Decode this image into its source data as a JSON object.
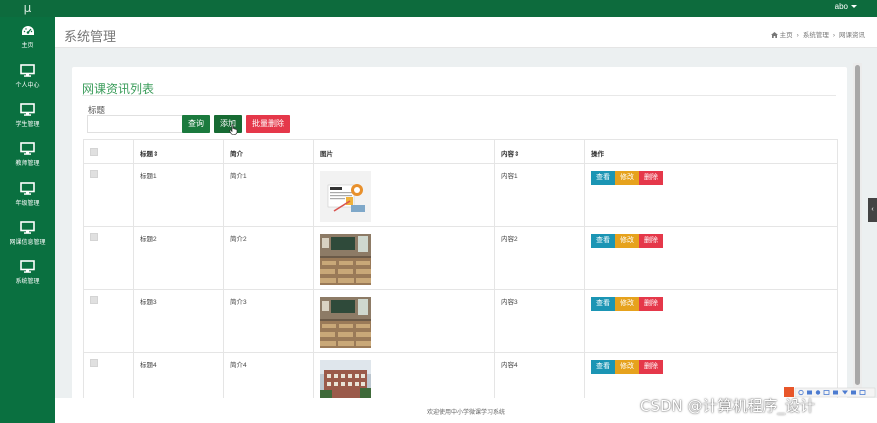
{
  "app": {
    "logo": "μ",
    "user": "abo"
  },
  "nav": [
    {
      "label": "主页",
      "icon": "dashboard-icon"
    },
    {
      "label": "个人中心",
      "icon": "monitor-icon"
    },
    {
      "label": "学生管理",
      "icon": "monitor-icon"
    },
    {
      "label": "教师管理",
      "icon": "monitor-icon"
    },
    {
      "label": "年级管理",
      "icon": "monitor-icon"
    },
    {
      "label": "网课信息管理",
      "icon": "monitor-icon"
    },
    {
      "label": "系统管理",
      "icon": "monitor-icon"
    }
  ],
  "header": {
    "title": "系统管理",
    "breadcrumb": [
      "主页",
      "系统管理",
      "网课资讯"
    ]
  },
  "panel": {
    "title": "网课资讯列表",
    "filter_label": "标题",
    "filter_value": "",
    "buttons": {
      "query": "查询",
      "add": "添加",
      "batch_delete": "批量删除"
    }
  },
  "table": {
    "headers": [
      "标题",
      "简介",
      "图片",
      "内容",
      "操作"
    ],
    "sort_mark": "⇕",
    "rows": [
      {
        "title": "标题1",
        "intro": "简介1",
        "image": "news-illustration",
        "content": "内容1"
      },
      {
        "title": "标题2",
        "intro": "简介2",
        "image": "classroom-photo",
        "content": "内容2"
      },
      {
        "title": "标题3",
        "intro": "简介3",
        "image": "classroom-photo",
        "content": "内容3"
      },
      {
        "title": "标题4",
        "intro": "简介4",
        "image": "school-building-photo",
        "content": "内容4"
      }
    ],
    "actions": {
      "view": "查看",
      "edit": "修改",
      "delete": "删除"
    }
  },
  "footer": {
    "text": "欢迎使用中小学微课学习系统"
  },
  "watermark": "CSDN @计算机程序_设计"
}
